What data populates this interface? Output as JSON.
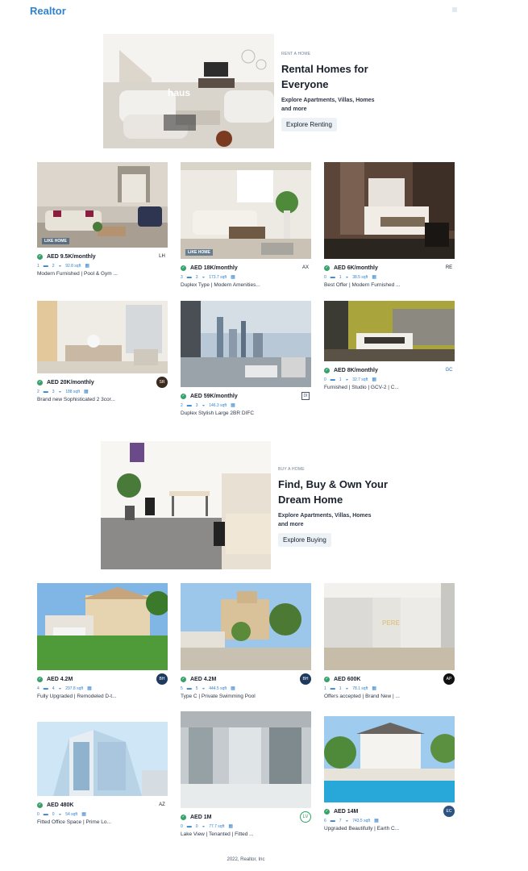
{
  "header": {
    "logo": "Realtor"
  },
  "rent_banner": {
    "purpose": "RENT A HOME",
    "title1": "Rental Homes for",
    "title2": "Everyone",
    "desc1": "Explore Apartments, Villas, Homes",
    "desc2": "and more",
    "button": "Explore Renting",
    "image_watermark": "haus"
  },
  "rent_properties": [
    {
      "price": "AED 9.5K/monthly",
      "rooms": "1",
      "baths": "2",
      "area": "92.8 sqft",
      "title": "Modern Furnished | Pool & Gym ...",
      "agency_color": "#1a202c",
      "agency": "LH"
    },
    {
      "price": "AED 18K/monthly",
      "rooms": "3",
      "baths": "3",
      "area": "173.7 sqft",
      "title": "Duplex Type | Modern Amenities...",
      "agency_color": "#1a202c",
      "agency": "AX"
    },
    {
      "price": "AED 6K/monthly",
      "rooms": "0",
      "baths": "1",
      "area": "38.5 sqft",
      "title": "Best Offer | Modern Furnished ...",
      "agency_color": "#1a202c",
      "agency": "RE"
    },
    {
      "price": "AED 20K/monthly",
      "rooms": "2",
      "baths": "3",
      "area": "188 sqft",
      "title": "Brand new Sophisticated 2 3cor...",
      "agency_color": "#3b2a1e",
      "agency": "SR"
    },
    {
      "price": "AED 59K/monthly",
      "rooms": "2",
      "baths": "3",
      "area": "146.3 sqft",
      "title": "Duplex Stylish Large 2BR DIFC",
      "agency_color": "#4a5568",
      "agency": "DI"
    },
    {
      "price": "AED 8K/monthly",
      "rooms": "0",
      "baths": "1",
      "area": "32.7 sqft",
      "title": "Furnished | Studio | GCV-2 | C...",
      "agency_color": "#2b6cb0",
      "agency": "GC"
    }
  ],
  "sale_banner": {
    "purpose": "BUY A HOME",
    "title1": "Find, Buy & Own Your",
    "title2": "Dream Home",
    "desc1": "Explore Apartments, Villas, Homes",
    "desc2": "and more",
    "button": "Explore Buying"
  },
  "sale_properties": [
    {
      "price": "AED 4.2M",
      "rooms": "4",
      "baths": "4",
      "area": "297.8 sqft",
      "title": "Fully Upgraded | Remodeled D-t...",
      "agency_color": "#1e3a5f",
      "agency": "BH"
    },
    {
      "price": "AED 4.2M",
      "rooms": "5",
      "baths": "5",
      "area": "444.5 sqft",
      "title": "Type C | Private Swimming Pool",
      "agency_color": "#1e3a5f",
      "agency": "BH"
    },
    {
      "price": "AED 600K",
      "rooms": "1",
      "baths": "1",
      "area": "78.1 sqft",
      "title": "Offers accepted | Brand New | ...",
      "agency_color": "#111111",
      "agency": "AP"
    },
    {
      "price": "AED 480K",
      "rooms": "0",
      "baths": "0",
      "area": "54 sqft",
      "title": "Fitted Office Space | Prime Lo...",
      "agency_color": "#1a202c",
      "agency": "AZ"
    },
    {
      "price": "AED 1M",
      "rooms": "0",
      "baths": "0",
      "area": "77.7 sqft",
      "title": "Lake View | Tenanted | Fitted ...",
      "agency_color": "#38a169",
      "agency": "LV"
    },
    {
      "price": "AED 14M",
      "rooms": "6",
      "baths": "7",
      "area": "743.5 sqft",
      "title": "Upgraded Beautifully | Earth C...",
      "agency_color": "#2c5282",
      "agency": "EC"
    }
  ],
  "footer": {
    "text": "2022, Realtor, Inc"
  }
}
